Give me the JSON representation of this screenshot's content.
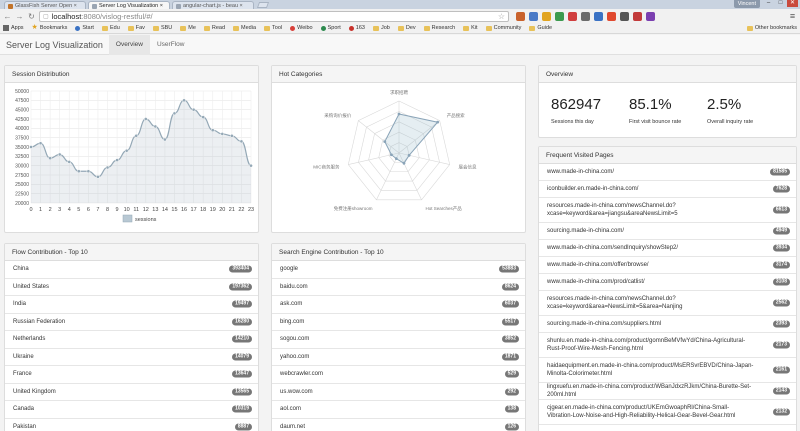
{
  "browser": {
    "tabs": [
      {
        "title": "GlassFish Server Open ×",
        "active": false
      },
      {
        "title": "Server Log Visualization ×",
        "active": true
      },
      {
        "title": "angular-chart.js - beau ×",
        "active": false
      }
    ],
    "user_label": "Vincent",
    "url_host": "localhost",
    "url_path": ":8080/vislog-restful/#/",
    "bookmarks": [
      "Apps",
      "Bookmarks",
      "Start",
      "Edu",
      "Fav",
      "SBU",
      "Me",
      "Read",
      "Media",
      "Tool",
      "Weibo",
      "Sport",
      "163",
      "Job",
      "Dev",
      "Research",
      "Kit",
      "Community",
      "Guide"
    ],
    "other_bookmarks": "Other bookmarks"
  },
  "appnav": {
    "brand": "Server Log Visualization",
    "tabs": [
      "Overview",
      "UserFlow"
    ]
  },
  "session": {
    "title": "Session Distribution",
    "legend": "sessions",
    "series_color": "#94a8b6"
  },
  "hot": {
    "title": "Hot Categories",
    "labels": [
      "求职招聘",
      "产品搜索",
      "展会信息",
      "Hot Searches产品",
      "免费注册showroom",
      "MIC商务服务",
      "采购询价报价"
    ]
  },
  "overview": {
    "title": "Overview",
    "kpis": [
      {
        "value": "862947",
        "label": "Sessions this day"
      },
      {
        "value": "85.1%",
        "label": "First visit bounce rate"
      },
      {
        "value": "2.5%",
        "label": "Overall inquiry rate"
      }
    ]
  },
  "frequent": {
    "title": "Frequent Visited Pages",
    "rows": [
      {
        "text": "www.made-in-china.com/",
        "count": "81585"
      },
      {
        "text": "iconbuilder.en.made-in-china.com/",
        "count": "7628"
      },
      {
        "text": "resources.made-in-china.com/newsChannel.do?xcase=keyword&area=jiangsu&areaNewsLimit=5",
        "count": "6613"
      },
      {
        "text": "sourcing.made-in-china.com/",
        "count": "4949"
      },
      {
        "text": "www.made-in-china.com/sendInquiry/showStep2/",
        "count": "3934"
      },
      {
        "text": "www.made-in-china.com/offer/browse/",
        "count": "3174"
      },
      {
        "text": "www.made-in-china.com/prod/catlist/",
        "count": "3108"
      },
      {
        "text": "resources.made-in-china.com/newsChannel.do?xcase=keyword&area=NewsLimit=5&area=Nanjing",
        "count": "2562"
      },
      {
        "text": "sourcing.made-in-china.com/suppliers.html",
        "count": "2393"
      },
      {
        "text": "shunlu.en.made-in-china.com/product/gomnBeMVfwYd/China-Agricultural-Rust-Proof-Wire-Mesh-Fencing.html",
        "count": "2173"
      },
      {
        "text": "haidaequipment.en.made-in-china.com/product/MsERSvrEBVD/China-Japan-Minolta-Colorimeter.html",
        "count": "2161"
      },
      {
        "text": "lingxuefu.en.made-in-china.com/product/WBanJdxzRJkm/China-Burette-Set-200ml.html",
        "count": "2143"
      },
      {
        "text": "cjgear.en.made-in-china.com/product/UKEmGwoaphRl/China-Small-Vibration-Low-Noise-and-High-Reliability-Helical-Gear-Bevel-Gear.html",
        "count": "2132"
      }
    ]
  },
  "flow": {
    "title": "Flow Contribution - Top 10",
    "rows": [
      {
        "name": "China",
        "count": "393404"
      },
      {
        "name": "United States",
        "count": "197362"
      },
      {
        "name": "India",
        "count": "19497"
      },
      {
        "name": "Russian Federation",
        "count": "16280"
      },
      {
        "name": "Netherlands",
        "count": "14210"
      },
      {
        "name": "Ukraine",
        "count": "14079"
      },
      {
        "name": "France",
        "count": "13647"
      },
      {
        "name": "United Kingdom",
        "count": "13565"
      },
      {
        "name": "Canada",
        "count": "10319"
      },
      {
        "name": "Pakistan",
        "count": "8887"
      }
    ]
  },
  "search": {
    "title": "Search Engine Contribution - Top 10",
    "rows": [
      {
        "name": "google",
        "count": "53883"
      },
      {
        "name": "baidu.com",
        "count": "8624"
      },
      {
        "name": "ask.com",
        "count": "6037"
      },
      {
        "name": "bing.com",
        "count": "5517"
      },
      {
        "name": "sogou.com",
        "count": "3852"
      },
      {
        "name": "yahoo.com",
        "count": "1871"
      },
      {
        "name": "webcrawler.com",
        "count": "529"
      },
      {
        "name": "us.wow.com",
        "count": "292"
      },
      {
        "name": "aol.com",
        "count": "138"
      },
      {
        "name": "daum.net",
        "count": "126"
      }
    ]
  },
  "chart_data": [
    {
      "type": "area",
      "title": "Session Distribution",
      "x": [
        0,
        1,
        2,
        3,
        4,
        5,
        6,
        7,
        8,
        9,
        10,
        11,
        12,
        13,
        14,
        15,
        16,
        17,
        18,
        19,
        20,
        21,
        22,
        23
      ],
      "series": [
        {
          "name": "sessions",
          "values": [
            35000,
            36000,
            32000,
            33000,
            31000,
            28500,
            28500,
            27000,
            29500,
            31500,
            34000,
            38000,
            42500,
            40500,
            37000,
            44000,
            47500,
            45000,
            43000,
            39500,
            38500,
            38000,
            36500,
            30000
          ]
        }
      ],
      "ylim": [
        20000,
        50000
      ],
      "yticks": [
        20000,
        22500,
        25000,
        27500,
        30000,
        32500,
        35000,
        37500,
        40000,
        42500,
        45000,
        47500,
        50000
      ],
      "grid": true,
      "legend": "bottom"
    },
    {
      "type": "radar",
      "title": "Hot Categories",
      "categories": [
        "求职招聘",
        "产品搜索",
        "展会信息",
        "Hot Searches产品",
        "免费注册showroom",
        "MIC商务服务",
        "采购询价报价"
      ],
      "values": [
        75,
        95,
        20,
        22,
        12,
        15,
        35
      ],
      "max": 100
    }
  ]
}
